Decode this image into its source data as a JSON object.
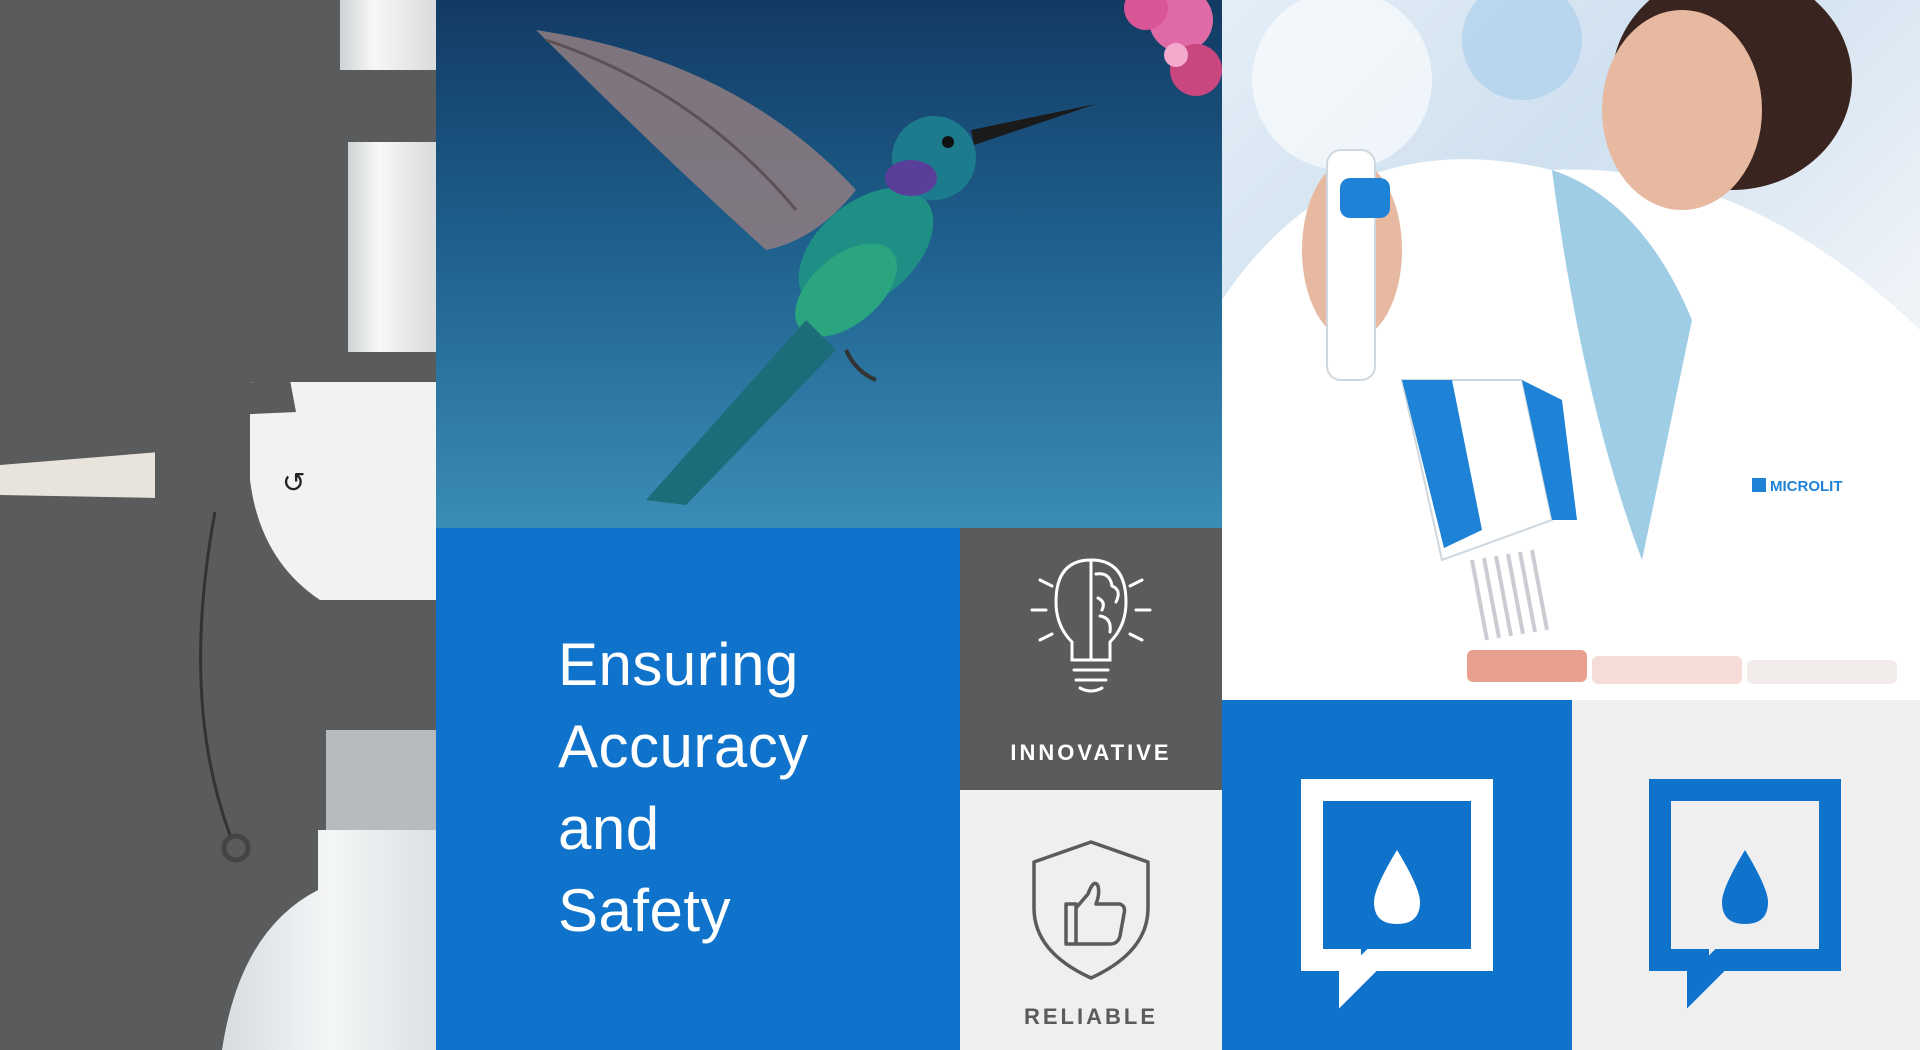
{
  "headline": {
    "line1": "Ensuring",
    "line2": "Accuracy",
    "line3": "and",
    "line4": "Safety"
  },
  "tags": {
    "innovative": "INNOVATIVE",
    "reliable": "RELIABLE"
  },
  "lab_photo": {
    "coat_logo": "MICROLIT"
  },
  "colors": {
    "brand_blue": "#0f73cc",
    "dark_grey": "#5a5b5d",
    "light_grey": "#efefef",
    "white": "#ffffff"
  },
  "icons": [
    "lightbulb-brain-icon",
    "shield-thumbs-up-icon",
    "drop-logo-icon"
  ]
}
